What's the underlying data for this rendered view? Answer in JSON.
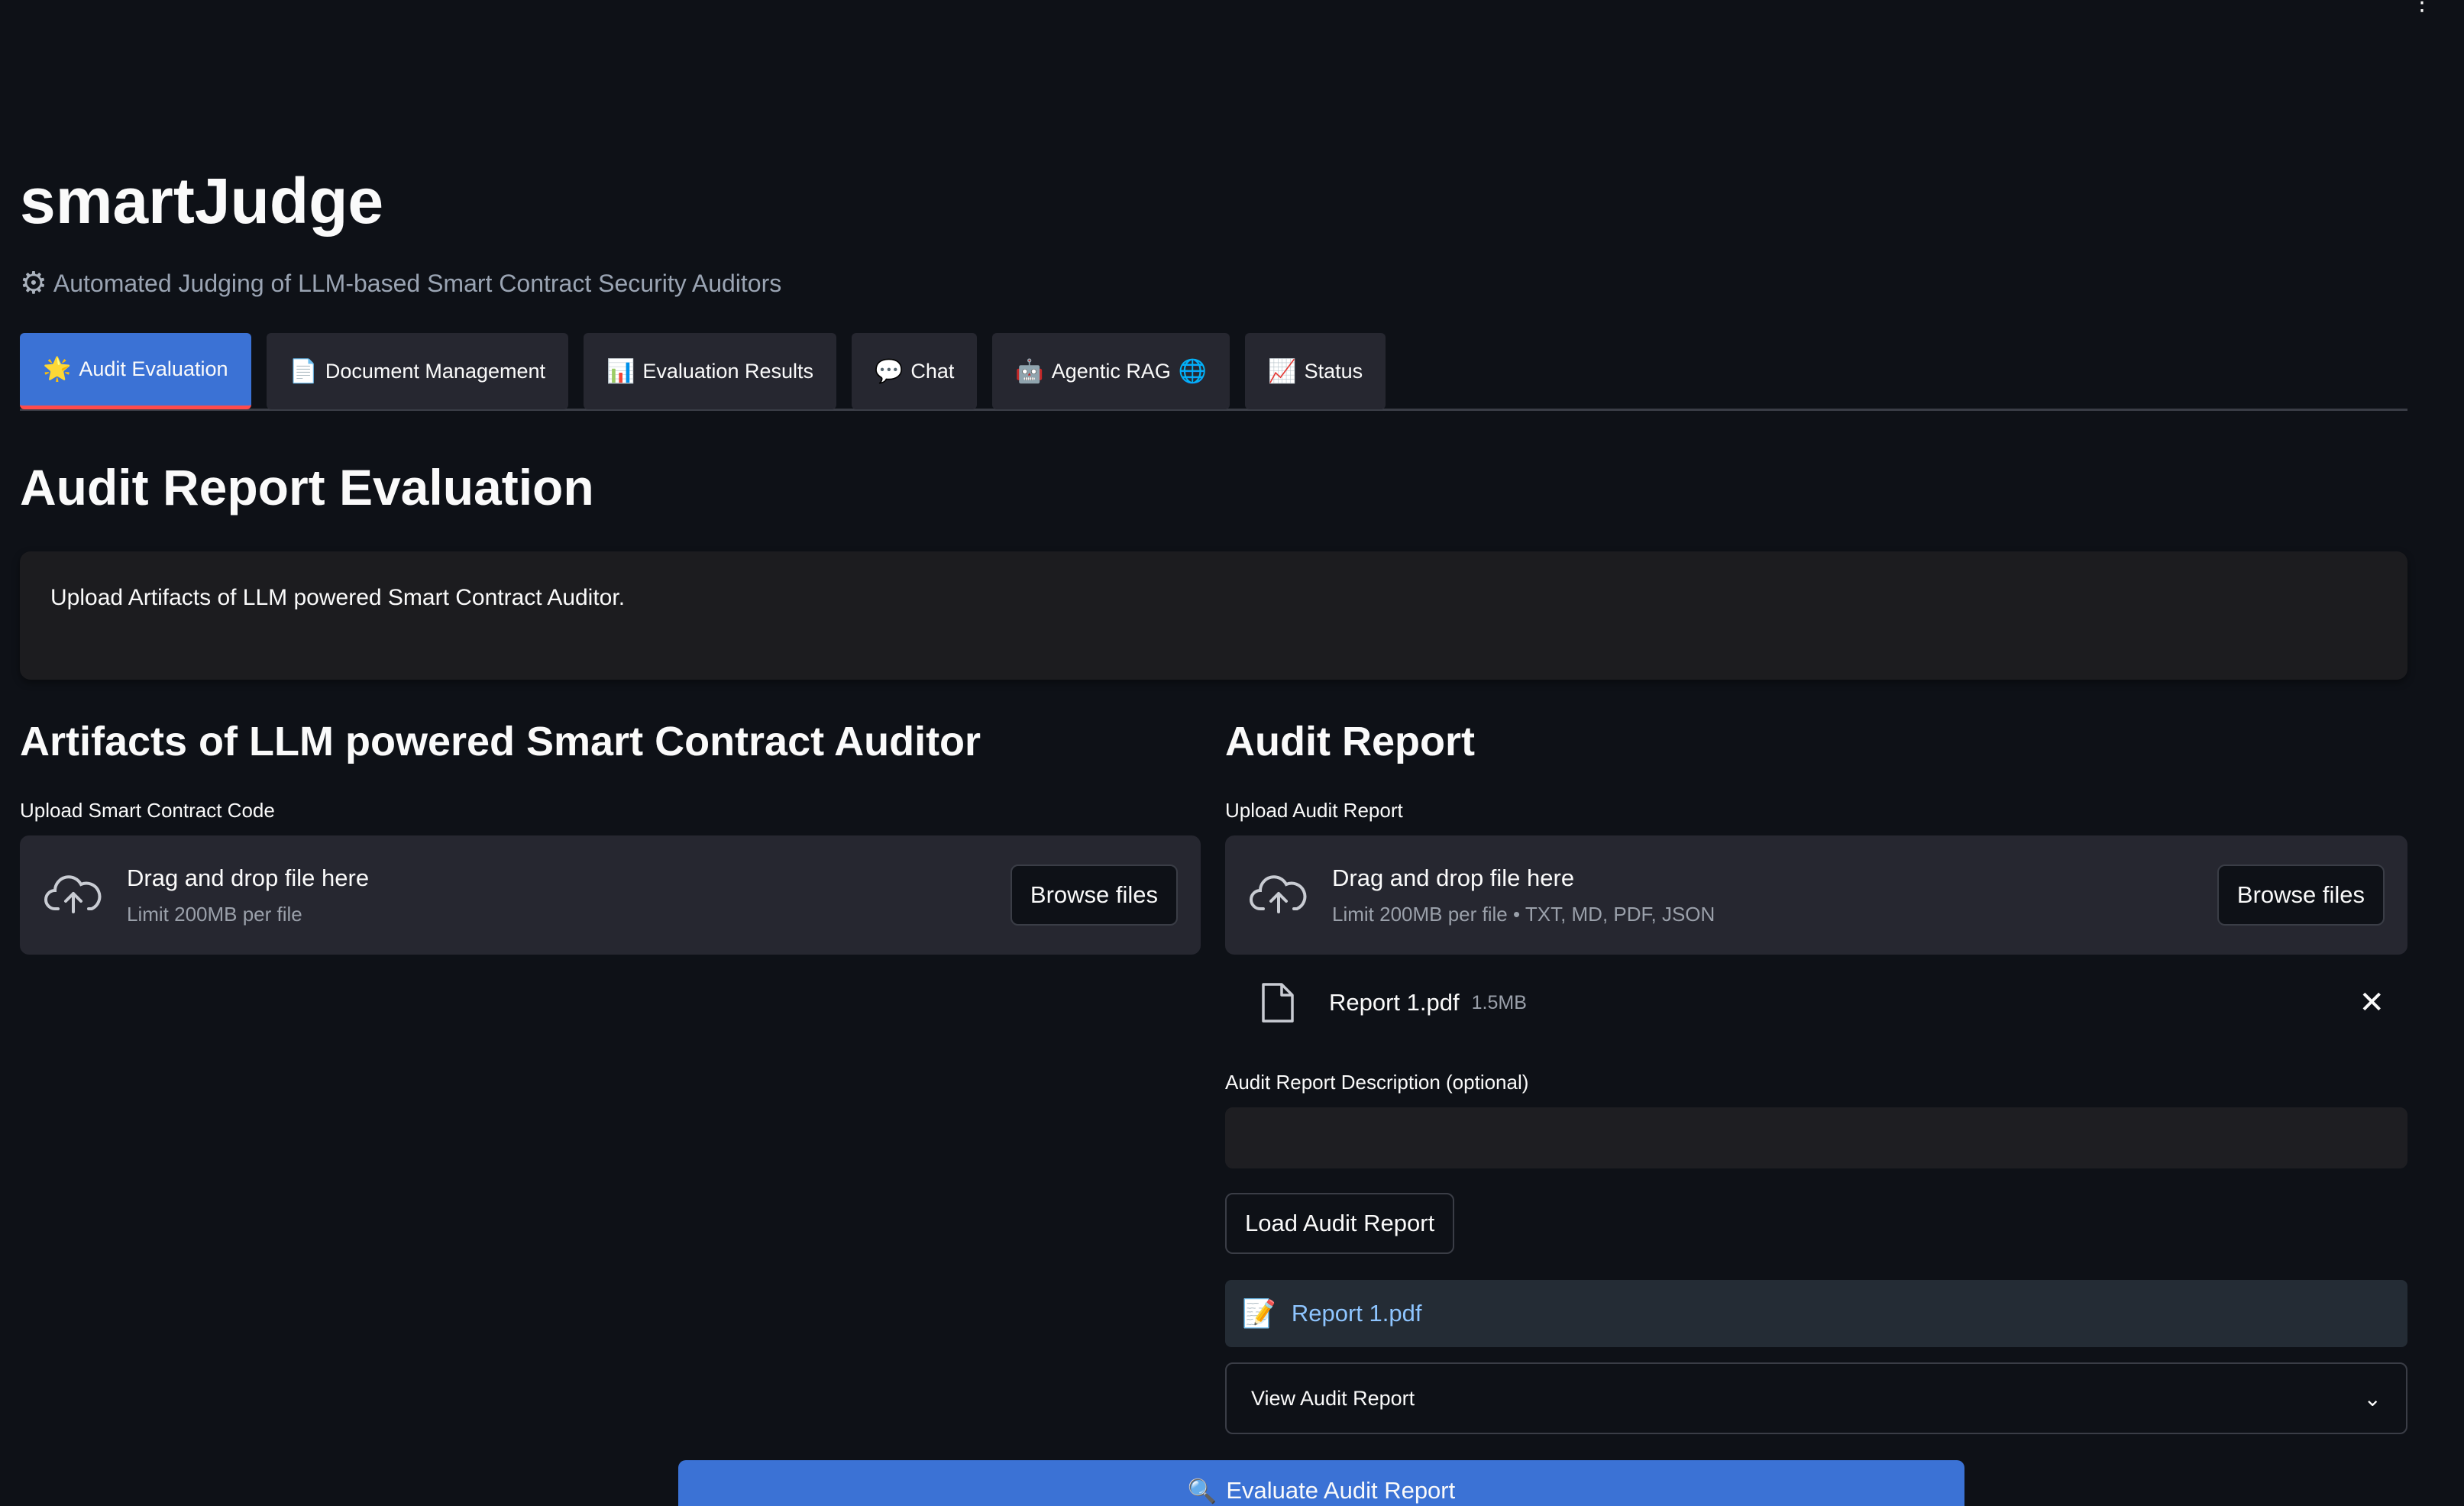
{
  "app": {
    "title": "smartJudge",
    "subtitle": "Automated Judging of LLM-based Smart Contract Security Auditors",
    "subtitle_icon": "gear-icon",
    "top_menu_icon": "more-menu-icon"
  },
  "tabs": [
    {
      "label": "Audit Evaluation",
      "icon": "star-icon",
      "glyph": "🌟",
      "active": true
    },
    {
      "label": "Document Management",
      "icon": "document-icon",
      "glyph": "📄",
      "active": false
    },
    {
      "label": "Evaluation Results",
      "icon": "bar-chart-icon",
      "glyph": "📊",
      "active": false
    },
    {
      "label": "Chat",
      "icon": "speech-bubble-icon",
      "glyph": "💬",
      "active": false
    },
    {
      "label": "Agentic RAG",
      "icon": "robot-icon",
      "glyph": "🤖",
      "suffix_glyph": "🌐",
      "active": false
    },
    {
      "label": "Status",
      "icon": "line-chart-icon",
      "glyph": "📈",
      "active": false
    }
  ],
  "main": {
    "heading": "Audit Report Evaluation",
    "info": "Upload Artifacts of LLM powered Smart Contract Auditor."
  },
  "left_column": {
    "heading": "Artifacts of LLM powered Smart Contract Auditor",
    "upload_label": "Upload Smart Contract Code",
    "dropzone_main": "Drag and drop file here",
    "dropzone_sub": "Limit 200MB per file",
    "browse_label": "Browse files"
  },
  "right_column": {
    "heading": "Audit Report",
    "upload_label": "Upload Audit Report",
    "dropzone_main": "Drag and drop file here",
    "dropzone_sub": "Limit 200MB per file • TXT, MD, PDF, JSON",
    "browse_label": "Browse files",
    "uploaded_file": {
      "name": "Report 1.pdf",
      "size": "1.5MB"
    },
    "description_label": "Audit Report Description (optional)",
    "description_value": "",
    "load_button": "Load Audit Report",
    "loaded_file": "Report 1.pdf",
    "expander_label": "View Audit Report"
  },
  "evaluate_button": "Evaluate Audit Report",
  "colors": {
    "background": "#0e1117",
    "accent": "#3b72d5",
    "active_underline": "#ff4b4b",
    "panel": "#262730"
  }
}
